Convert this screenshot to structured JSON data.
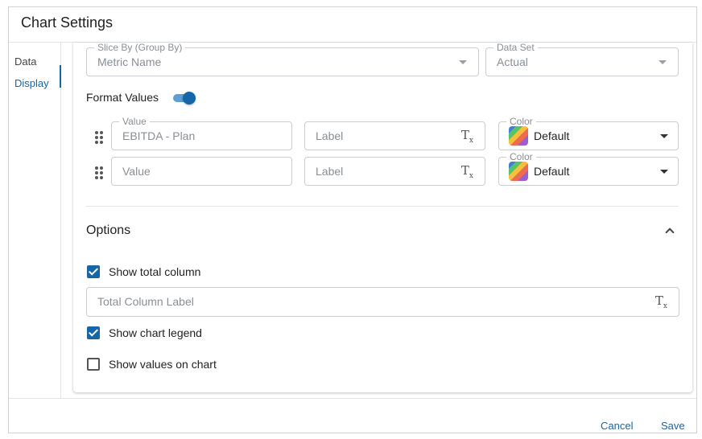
{
  "header": {
    "title": "Chart Settings"
  },
  "sidebar": {
    "items": [
      {
        "label": "Data"
      },
      {
        "label": "Display"
      }
    ]
  },
  "slice_by": {
    "legend": "Slice By (Group By)",
    "value": "Metric Name"
  },
  "data_set": {
    "legend": "Data Set",
    "value": "Actual"
  },
  "format_values": {
    "label": "Format Values",
    "enabled": true,
    "rows": [
      {
        "value_legend": "Value",
        "value": "EBITDA - Plan",
        "label_placeholder": "Label",
        "color_legend": "Color",
        "color": "Default"
      },
      {
        "value_placeholder": "Value",
        "label_placeholder": "Label",
        "color_legend": "Color",
        "color": "Default"
      }
    ]
  },
  "options": {
    "title": "Options",
    "show_total_column": {
      "label": "Show total column",
      "checked": true
    },
    "total_column_label": {
      "placeholder": "Total Column Label"
    },
    "show_chart_legend": {
      "label": "Show chart legend",
      "checked": true
    },
    "show_values_on_chart": {
      "label": "Show values on chart",
      "checked": false
    }
  },
  "footer": {
    "cancel_label": "Cancel",
    "save_label": "Save"
  },
  "colors": {
    "accent": "#1565a7",
    "toggle_track": "#5b9fd6",
    "border": "#c9cdd2"
  }
}
